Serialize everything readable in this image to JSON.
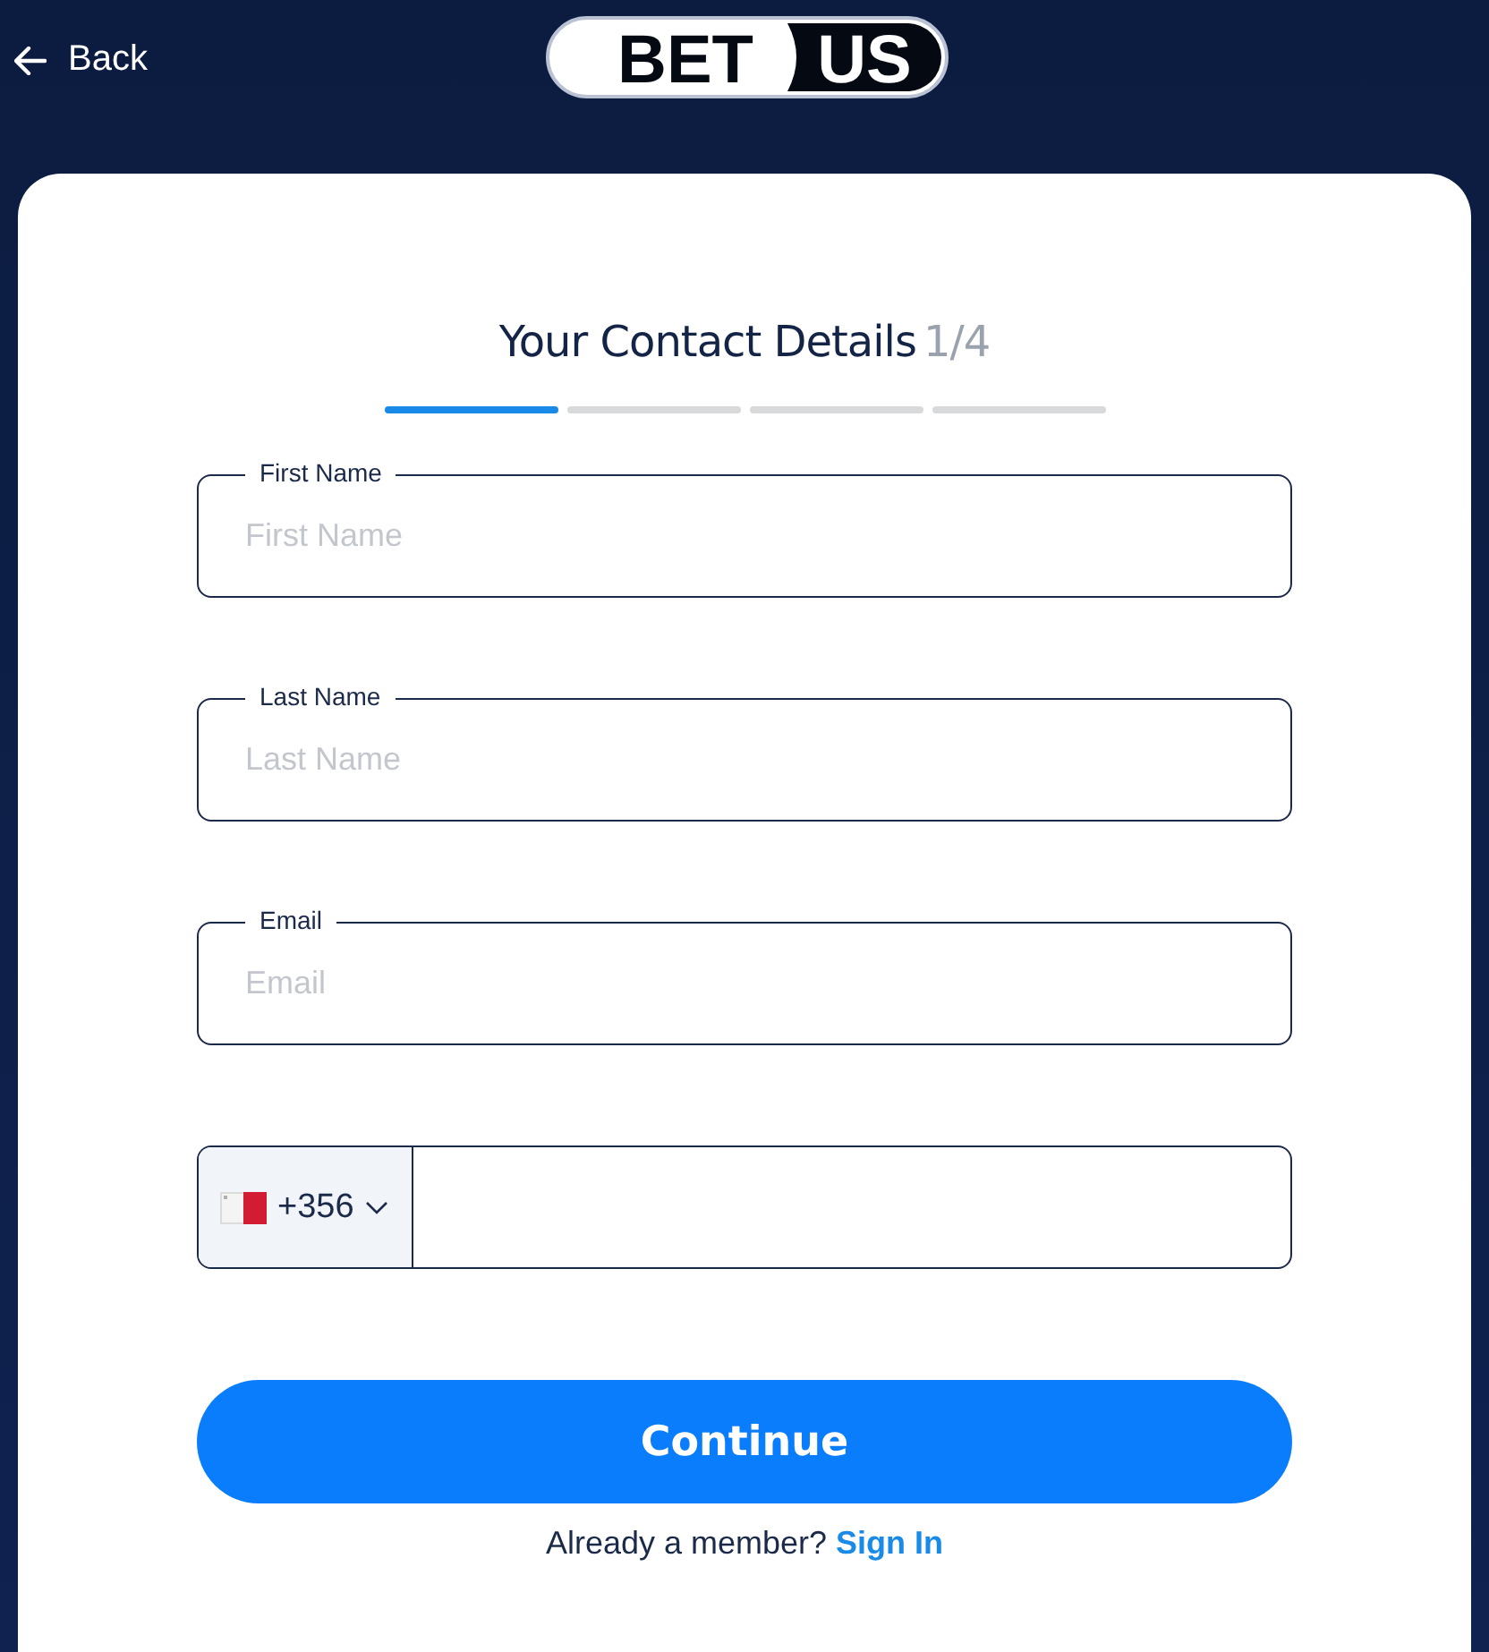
{
  "header": {
    "back": "Back",
    "logo": {
      "left": "BET",
      "right": "US"
    }
  },
  "form": {
    "title": "Your Contact Details",
    "step": "1/4",
    "steps": [
      {
        "active": true
      },
      {
        "active": false
      },
      {
        "active": false
      },
      {
        "active": false
      }
    ],
    "fields": [
      {
        "label": "First Name",
        "placeholder": "First Name"
      },
      {
        "label": "Last Name",
        "placeholder": "Last Name"
      },
      {
        "label": "Email",
        "placeholder": "Email"
      }
    ],
    "phone": {
      "code": "+356"
    },
    "submit": "Continue",
    "footer": {
      "text": "Already a member?",
      "link": "Sign In"
    }
  }
}
